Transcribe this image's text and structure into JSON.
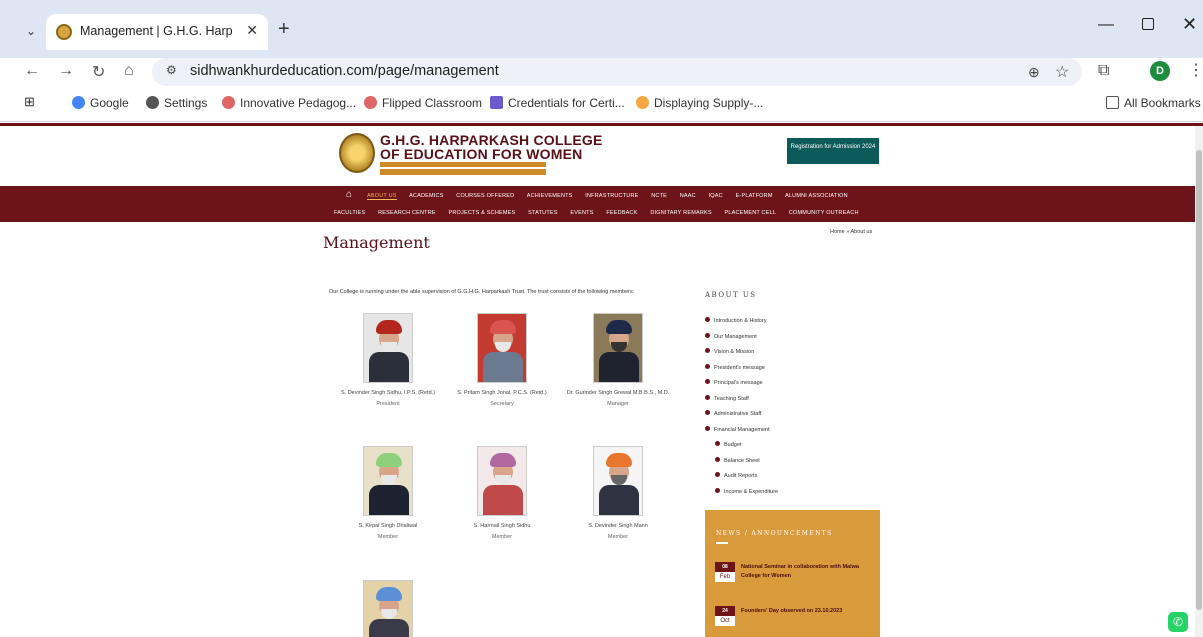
{
  "browser": {
    "tab_title": "Management | G.H.G. Harparka",
    "url": "sidhwankhurdeducation.com/page/management",
    "profile_initial": "D",
    "bookmarks": [
      {
        "label": "Google"
      },
      {
        "label": "Settings"
      },
      {
        "label": "Innovative Pedagog..."
      },
      {
        "label": "Flipped Classroom"
      },
      {
        "label": "Credentials for Certi..."
      },
      {
        "label": "Displaying Supply-..."
      }
    ],
    "all_bookmarks": "All Bookmarks"
  },
  "site": {
    "college_line1": "G.H.G. HARPARKASH COLLEGE",
    "college_line2": "OF EDUCATION FOR WOMEN",
    "register_btn": "Registration for Admission 2024",
    "nav_row1": [
      "ABOUT US",
      "ACADEMICS",
      "COURSES OFFERED",
      "ACHIEVEMENTS",
      "INFRASTRUCTURE",
      "NCTE",
      "NAAC",
      "IQAC",
      "E-PLATFORM",
      "ALUMNI ASSOCIATION"
    ],
    "nav_row2": [
      "FACULTIES",
      "RESEARCH CENTRE",
      "PROJECTS & SCHEMES",
      "STATUTES",
      "EVENTS",
      "FEEDBACK",
      "DIGNITARY REMARKS",
      "PLACEMENT CELL",
      "COMMUNITY OUTREACH"
    ],
    "page_title": "Management",
    "breadcrumb": "Home » About us",
    "intro": "Our College is running under the able supervision of G.G.H.G. Harparkash Trust. The trust consists of the following members:",
    "members": [
      {
        "name": "S. Devinder Singh Sidhu, I.P.S. (Retd.)",
        "role": "President"
      },
      {
        "name": "S. Pritam Singh Jonal, P.C.S. (Retd.)",
        "role": "Secretary"
      },
      {
        "name": "Dr. Gurinder Singh Grewal M.B.B.S., M.D.",
        "role": "Manager"
      },
      {
        "name": "S. Kirpal Singh Dhaliwal",
        "role": "Member"
      },
      {
        "name": "S. Harmail Singh Sidhu",
        "role": "Member"
      },
      {
        "name": "S. Devinder Singh Mann",
        "role": "Member"
      }
    ],
    "sidebar_title": "ABOUT US",
    "sidebar_links": [
      "Introduction & History",
      "Our Management",
      "Vision & Mission",
      "President's message",
      "Principal's message",
      "Teaching Staff",
      "Administrative Staff",
      "Financial Management"
    ],
    "sidebar_sublinks": [
      "Budget",
      "Balance Sheet",
      "Audit Reports",
      "Income & Expenditure"
    ],
    "news_title": "NEWS / ANNOUNCEMENTS",
    "news": [
      {
        "day": "08",
        "month": "Feb",
        "text": "National Seminar in collaboration with Malwa College for Women"
      },
      {
        "day": "24",
        "month": "Oct",
        "text": "Founders' Day observed on 23.10.2023"
      }
    ]
  }
}
